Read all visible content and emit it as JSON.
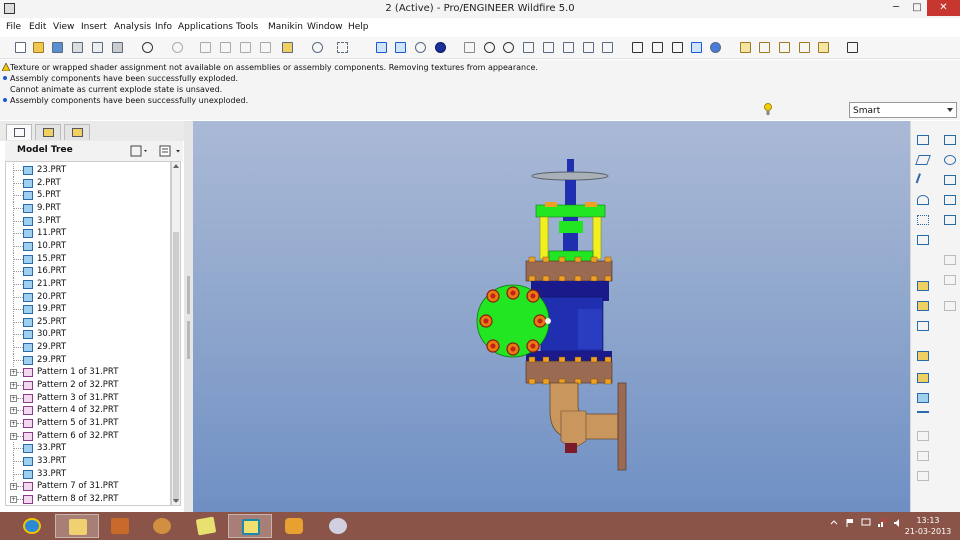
{
  "window": {
    "title": "2 (Active) - Pro/ENGINEER Wildfire 5.0",
    "min_glyph": "─",
    "max_glyph": "□",
    "close_glyph": "✕"
  },
  "menu": [
    "File",
    "Edit",
    "View",
    "Insert",
    "Analysis",
    "Info",
    "Applications",
    "Tools",
    "Manikin",
    "Window",
    "Help"
  ],
  "toolbar": {
    "icons": [
      "new-icon",
      "open-icon",
      "save-icon",
      "print-icon",
      "email-icon",
      "save-copy-icon",
      "undo-icon",
      "redo-icon",
      "cut-icon",
      "copy-icon",
      "paste-icon",
      "paste-special-icon",
      "regenerate-icon",
      "find-icon",
      "select-box-icon",
      "datum-display-icon",
      "repaint-icon",
      "spin-center-icon",
      "appearance-icon",
      "orient-mode-icon",
      "zoom-in-icon",
      "zoom-out-icon",
      "refit-icon",
      "reorient-icon",
      "saved-views-icon",
      "layers-icon",
      "view-manager-icon",
      "wireframe-icon",
      "hidden-line-icon",
      "no-hidden-icon",
      "shading-icon",
      "enhanced-realism-icon",
      "datum-planes-icon",
      "datum-axes-icon",
      "datum-points-icon",
      "coordinate-systems-icon",
      "context-help-icon"
    ]
  },
  "messages": [
    "Texture or wrapped shader assignment not available on assemblies or assembly components. Removing textures from appearance.",
    "Assembly components have been successfully exploded.",
    "Cannot animate as current explode state is unsaved.",
    "Assembly components have been successfully unexploded."
  ],
  "filter": {
    "selected": "Smart"
  },
  "model_tree": {
    "title": "Model Tree",
    "items": [
      {
        "label": "23.PRT",
        "kind": "part"
      },
      {
        "label": "2.PRT",
        "kind": "part"
      },
      {
        "label": "5.PRT",
        "kind": "part"
      },
      {
        "label": "9.PRT",
        "kind": "part"
      },
      {
        "label": "3.PRT",
        "kind": "part"
      },
      {
        "label": "11.PRT",
        "kind": "part"
      },
      {
        "label": "10.PRT",
        "kind": "part"
      },
      {
        "label": "15.PRT",
        "kind": "part"
      },
      {
        "label": "16.PRT",
        "kind": "part"
      },
      {
        "label": "21.PRT",
        "kind": "part"
      },
      {
        "label": "20.PRT",
        "kind": "part"
      },
      {
        "label": "19.PRT",
        "kind": "part"
      },
      {
        "label": "25.PRT",
        "kind": "part"
      },
      {
        "label": "30.PRT",
        "kind": "part"
      },
      {
        "label": "29.PRT",
        "kind": "part"
      },
      {
        "label": "29.PRT",
        "kind": "part"
      },
      {
        "label": "Pattern 1 of 31.PRT",
        "kind": "pattern"
      },
      {
        "label": "Pattern 2 of 32.PRT",
        "kind": "pattern"
      },
      {
        "label": "Pattern 3 of 31.PRT",
        "kind": "pattern"
      },
      {
        "label": "Pattern 4 of 32.PRT",
        "kind": "pattern"
      },
      {
        "label": "Pattern 5 of 31.PRT",
        "kind": "pattern"
      },
      {
        "label": "Pattern 6 of 32.PRT",
        "kind": "pattern"
      },
      {
        "label": "33.PRT",
        "kind": "part"
      },
      {
        "label": "33.PRT",
        "kind": "part"
      },
      {
        "label": "33.PRT",
        "kind": "part"
      },
      {
        "label": "Pattern 7 of 31.PRT",
        "kind": "pattern"
      },
      {
        "label": "Pattern 8 of 32.PRT",
        "kind": "pattern"
      }
    ]
  },
  "clock": {
    "time": "13:13",
    "date": "21-03-2013"
  },
  "colors": {
    "flange_brown": "#9b6a52",
    "body_blue": "#1f2fb0",
    "yoke_green": "#22e622",
    "bolt_orange": "#f0a020",
    "pipe_bronze": "#c9965d",
    "handwheel_gray": "#a9b0b8",
    "column_yellow": "#f0f020"
  }
}
